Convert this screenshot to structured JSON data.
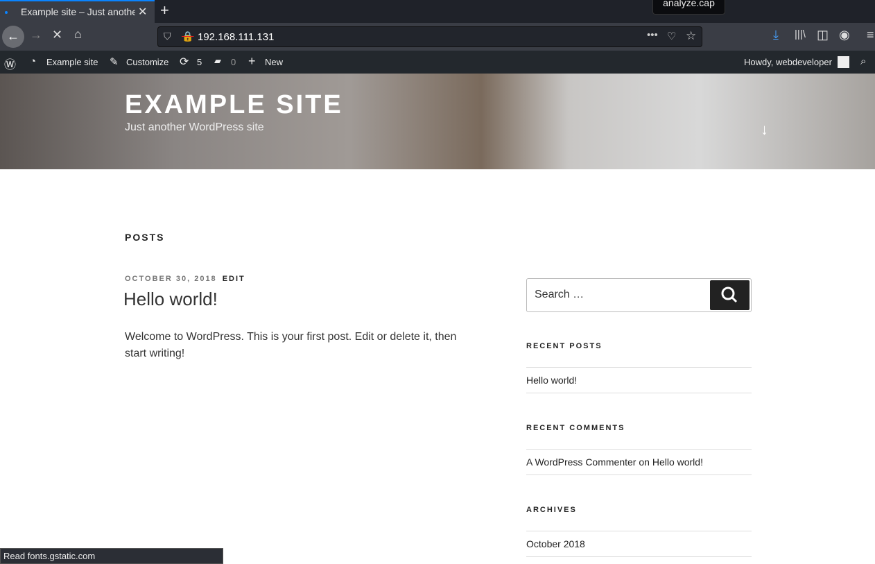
{
  "browser": {
    "tab_title": "Example site – Just another WordPress site",
    "tooltip": "analyze.cap",
    "url": "192.168.111.131",
    "status": "Read fonts.gstatic.com"
  },
  "adminbar": {
    "site": "Example site",
    "customize": "Customize",
    "updates": "5",
    "comments": "0",
    "new": "New",
    "howdy": "Howdy, webdeveloper"
  },
  "header": {
    "title": "EXAMPLE SITE",
    "tagline": "Just another WordPress site"
  },
  "main": {
    "heading": "POSTS",
    "post": {
      "date": "OCTOBER 30, 2018",
      "edit": "EDIT",
      "title": "Hello world!",
      "excerpt": "Welcome to WordPress. This is your first post. Edit or delete it, then start writing!"
    }
  },
  "sidebar": {
    "search_placeholder": "Search …",
    "recent_posts_title": "RECENT POSTS",
    "recent_posts": [
      "Hello world!"
    ],
    "recent_comments_title": "RECENT COMMENTS",
    "comment": {
      "author": "A WordPress Commenter",
      "on": "on",
      "post": "Hello world!"
    },
    "archives_title": "ARCHIVES",
    "archives": [
      "October 2018"
    ]
  }
}
